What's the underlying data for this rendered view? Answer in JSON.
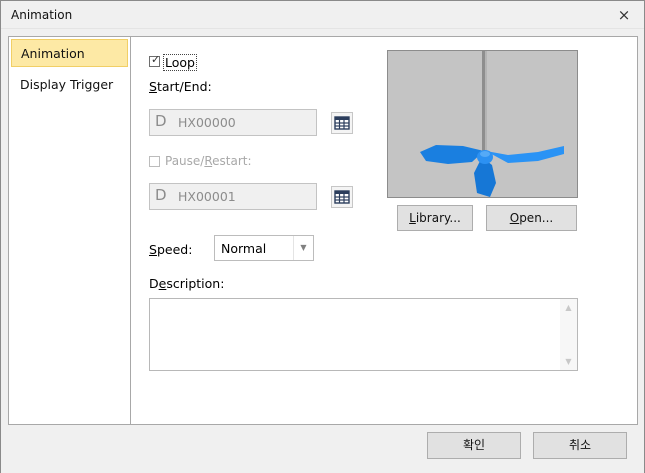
{
  "window": {
    "title": "Animation",
    "close_glyph": "×"
  },
  "sidebar": {
    "items": [
      {
        "label": "Animation",
        "selected": true
      },
      {
        "label": "Display Trigger",
        "selected": false
      }
    ]
  },
  "loop": {
    "label": "Loop",
    "checked": true
  },
  "start_end": {
    "label_underlined": "S",
    "label_rest": "tart/End:",
    "device_prefix": "D",
    "value": "HX00000"
  },
  "pause_restart": {
    "label_pre": "Pause/",
    "label_underlined": "R",
    "label_rest": "estart:",
    "checked": false,
    "enabled": false,
    "device_prefix": "D",
    "value": "HX00001"
  },
  "speed": {
    "label_underlined": "S",
    "label_rest": "peed:",
    "value": "Normal"
  },
  "description": {
    "label_pre": "D",
    "label_underlined": "e",
    "label_rest": "scription:",
    "value": ""
  },
  "preview": {
    "library_underlined": "L",
    "library_rest": "ibrary...",
    "open_underlined": "O",
    "open_rest": "pen...",
    "propeller_color": "#1e8cf0"
  },
  "footer": {
    "ok_label": "확인",
    "cancel_label": "취소"
  },
  "icons": {
    "checkbox": "check-icon",
    "device_browse": "grid-icon",
    "dropdown": "chevron-down-icon"
  }
}
